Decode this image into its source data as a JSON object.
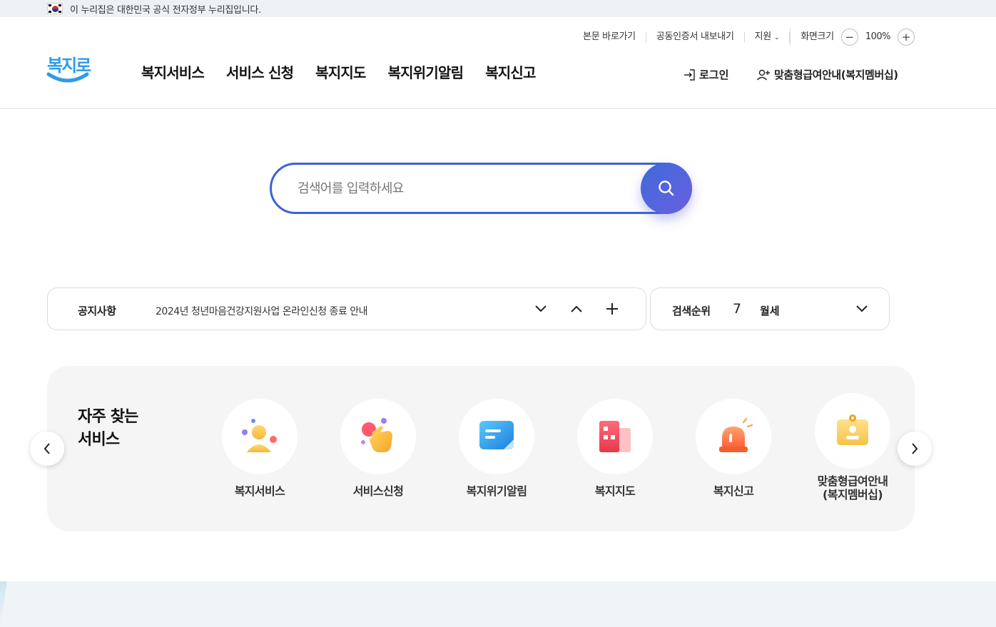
{
  "gov_banner": {
    "text": "이 누리집은 대한민국 공식 전자정부 누리집입니다."
  },
  "utility": {
    "skip_link": "본문 바로가기",
    "cert_export": "공동인증서 내보내기",
    "support": "지원",
    "zoom_label": "화면크기",
    "zoom_value": "100%",
    "zoom_minus": "−",
    "zoom_plus": "+"
  },
  "logo": {
    "text": "복지로"
  },
  "gnb": [
    "복지서비스",
    "서비스 신청",
    "복지지도",
    "복지위기알림",
    "복지신고"
  ],
  "account": {
    "login": "로그인",
    "membership": "맞춤형급여안내(복지멤버십)"
  },
  "search": {
    "placeholder": "검색어를 입력하세요",
    "value": ""
  },
  "notice": {
    "title": "공지사항",
    "text": "2024년 청년마음건강지원사업 온라인신청 종료 안내"
  },
  "search_rank": {
    "title": "검색순위",
    "rank": "7",
    "keyword": "월세"
  },
  "frequent": {
    "heading_line1": "자주 찾는",
    "heading_line2": "서비스",
    "items": [
      {
        "label": "복지서비스",
        "icon": "person-icon"
      },
      {
        "label": "서비스신청",
        "icon": "hand-tap-icon"
      },
      {
        "label": "복지위기알림",
        "icon": "message-icon"
      },
      {
        "label": "복지지도",
        "icon": "building-icon"
      },
      {
        "label": "복지신고",
        "icon": "siren-icon"
      },
      {
        "label": "맞춤형급여안내\n(복지멤버십)",
        "icon": "id-card-icon"
      }
    ]
  },
  "colors": {
    "accent": "#3f61d6",
    "logo": "#2f9be8",
    "panel": "#f5f5f5"
  }
}
